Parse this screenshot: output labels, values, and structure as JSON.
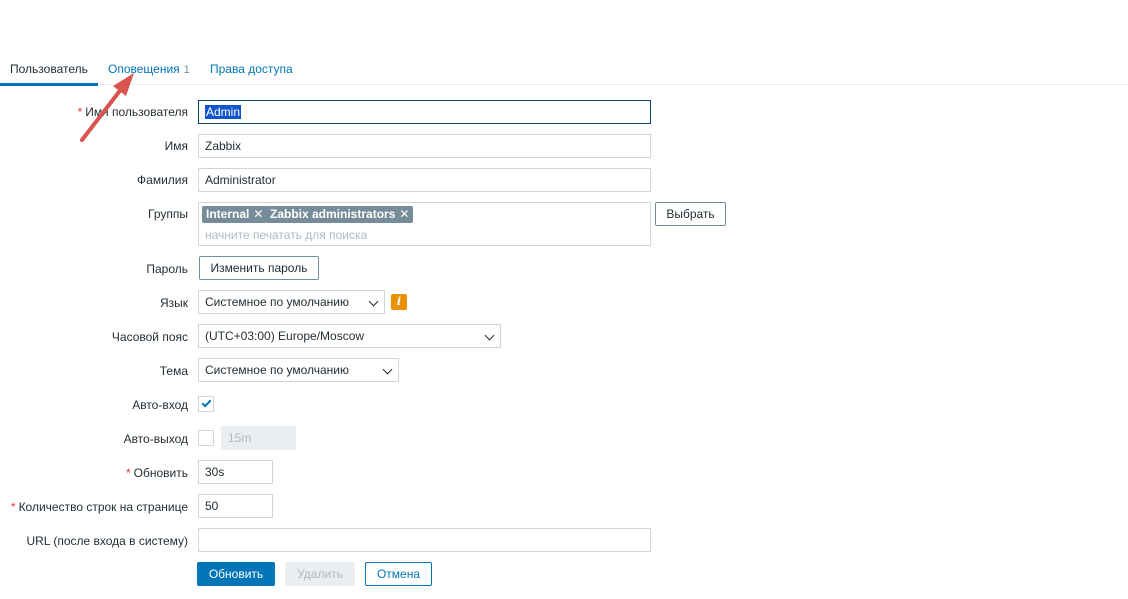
{
  "tabs": {
    "user": "Пользователь",
    "notifications": "Оповещения",
    "notifications_count": "1",
    "permissions": "Права доступа"
  },
  "form": {
    "username": {
      "label": "Имя пользователя",
      "required": "*",
      "value": "Admin"
    },
    "name": {
      "label": "Имя",
      "value": "Zabbix"
    },
    "surname": {
      "label": "Фамилия",
      "value": "Administrator"
    },
    "groups": {
      "label": "Группы",
      "chips": [
        "Internal",
        "Zabbix administrators"
      ],
      "remove_glyph": "✕",
      "placeholder": "начните печатать для поиска",
      "select_button": "Выбрать"
    },
    "password": {
      "label": "Пароль",
      "button": "Изменить пароль"
    },
    "language": {
      "label": "Язык",
      "value": "Системное по умолчанию",
      "info_icon": "i"
    },
    "timezone": {
      "label": "Часовой пояс",
      "value": "(UTC+03:00) Europe/Moscow"
    },
    "theme": {
      "label": "Тема",
      "value": "Системное по умолчанию"
    },
    "autologin": {
      "label": "Авто-вход",
      "checked": true
    },
    "autologout": {
      "label": "Авто-выход",
      "checked": false,
      "value": "15m"
    },
    "refresh": {
      "label": "Обновить",
      "required": "*",
      "value": "30s"
    },
    "rows_per_page": {
      "label": "Количество строк на странице",
      "required": "*",
      "value": "50"
    },
    "url": {
      "label": "URL (после входа в систему)",
      "value": ""
    }
  },
  "buttons": {
    "update": "Обновить",
    "delete": "Удалить",
    "cancel": "Отмена"
  },
  "colors": {
    "accent": "#0275b8",
    "annotation_arrow": "#d9534f",
    "info": "#e99003"
  }
}
